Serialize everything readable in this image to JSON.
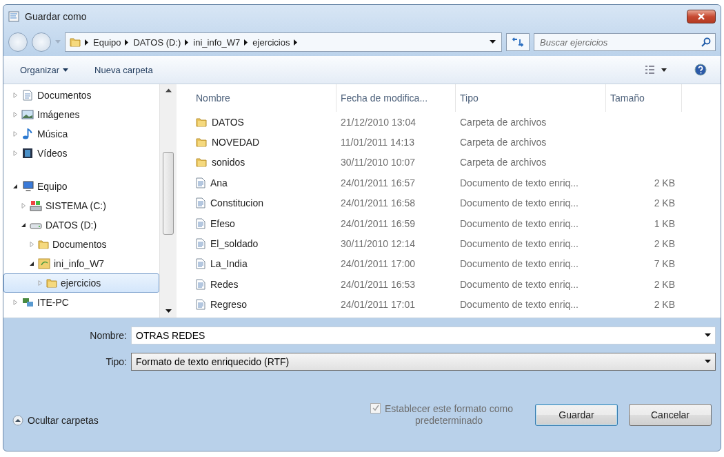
{
  "window": {
    "title": "Guardar como"
  },
  "address": {
    "crumbs": [
      "Equipo",
      "DATOS (D:)",
      "ini_info_W7",
      "ejercicios"
    ]
  },
  "search": {
    "placeholder": "Buscar ejercicios"
  },
  "toolbar": {
    "organize": "Organizar",
    "new_folder": "Nueva carpeta"
  },
  "sidebar": {
    "groups": [
      {
        "items": [
          {
            "label": "Documentos",
            "kind": "documents",
            "expanded": false,
            "selected": false
          },
          {
            "label": "Imágenes",
            "kind": "pictures",
            "expanded": false,
            "selected": false
          },
          {
            "label": "Música",
            "kind": "music",
            "expanded": false,
            "selected": false
          },
          {
            "label": "Vídeos",
            "kind": "videos",
            "expanded": false,
            "selected": false
          }
        ]
      },
      {
        "items": [
          {
            "label": "Equipo",
            "kind": "computer",
            "expanded": true,
            "selected": false,
            "children": [
              {
                "label": "SISTEMA (C:)",
                "kind": "system-drive",
                "expanded": false,
                "selected": false
              },
              {
                "label": "DATOS (D:)",
                "kind": "drive",
                "expanded": true,
                "selected": false,
                "children": [
                  {
                    "label": "Documentos",
                    "kind": "folder",
                    "expanded": false,
                    "selected": false
                  },
                  {
                    "label": "ini_info_W7",
                    "kind": "special-folder",
                    "expanded": true,
                    "selected": false,
                    "children": [
                      {
                        "label": "ejercicios",
                        "kind": "folder",
                        "expanded": false,
                        "selected": true
                      }
                    ]
                  }
                ]
              }
            ]
          },
          {
            "label": "ITE-PC",
            "kind": "network",
            "expanded": false,
            "selected": false
          }
        ]
      }
    ]
  },
  "table": {
    "columns": [
      "Nombre",
      "Fecha de modifica...",
      "Tipo",
      "Tamaño"
    ],
    "rows": [
      {
        "kind": "folder",
        "name": "DATOS",
        "date": "21/12/2010 13:04",
        "type": "Carpeta de archivos"
      },
      {
        "kind": "folder",
        "name": "NOVEDAD",
        "date": "11/01/2011 14:13",
        "type": "Carpeta de archivos"
      },
      {
        "kind": "folder",
        "name": "sonidos",
        "date": "30/11/2010 10:07",
        "type": "Carpeta de archivos"
      },
      {
        "kind": "document",
        "name": "Ana",
        "date": "24/01/2011 16:57",
        "type": "Documento de texto enriq...",
        "size": "2 KB"
      },
      {
        "kind": "document",
        "name": "Constitucion",
        "date": "24/01/2011 16:58",
        "type": "Documento de texto enriq...",
        "size": "2 KB"
      },
      {
        "kind": "document",
        "name": "Efeso",
        "date": "24/01/2011 16:59",
        "type": "Documento de texto enriq...",
        "size": "1 KB"
      },
      {
        "kind": "document",
        "name": "El_soldado",
        "date": "30/11/2010 12:14",
        "type": "Documento de texto enriq...",
        "size": "2 KB"
      },
      {
        "kind": "document",
        "name": "La_India",
        "date": "24/01/2011 17:00",
        "type": "Documento de texto enriq...",
        "size": "7 KB"
      },
      {
        "kind": "document",
        "name": "Redes",
        "date": "24/01/2011 16:53",
        "type": "Documento de texto enriq...",
        "size": "2 KB"
      },
      {
        "kind": "document",
        "name": "Regreso",
        "date": "24/01/2011 17:01",
        "type": "Documento de texto enriq...",
        "size": "2 KB"
      }
    ]
  },
  "form": {
    "name_label": "Nombre:",
    "name_value": "OTRAS REDES",
    "type_label": "Tipo:",
    "type_value": "Formato de texto enriquecido (RTF)"
  },
  "default_format": {
    "label": "Establecer este formato como predeterminado",
    "checked": true,
    "disabled": true
  },
  "hide_folders": "Ocultar carpetas",
  "buttons": [
    "Guardar",
    "Cancelar"
  ]
}
